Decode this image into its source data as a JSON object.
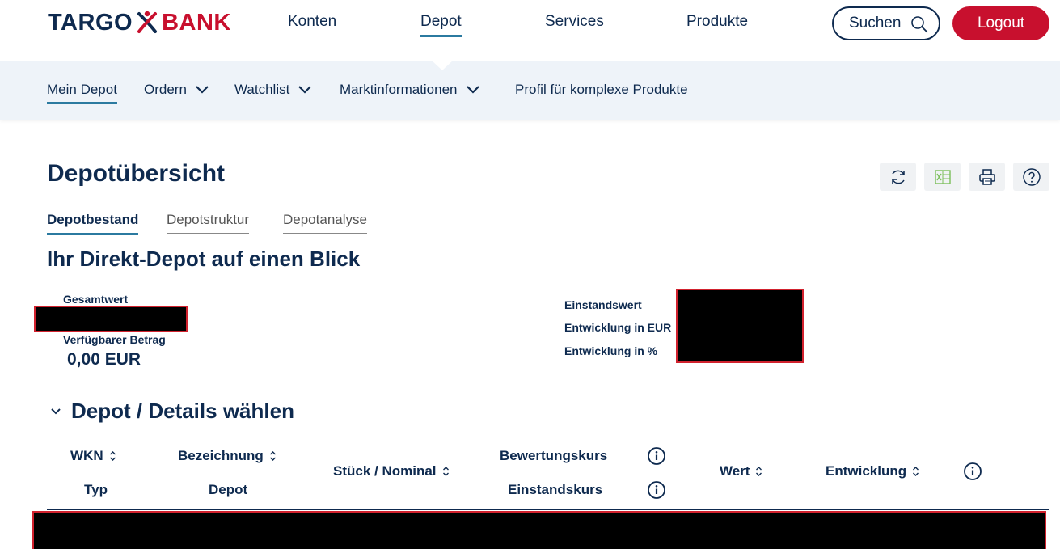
{
  "header": {
    "logo_left": "TARGO",
    "logo_right": "BANK",
    "nav": [
      {
        "label": "Konten"
      },
      {
        "label": "Depot"
      },
      {
        "label": "Services"
      },
      {
        "label": "Produkte"
      }
    ],
    "search_label": "Suchen",
    "logout_label": "Logout"
  },
  "subnav": {
    "items": [
      {
        "label": "Mein Depot"
      },
      {
        "label": "Ordern"
      },
      {
        "label": "Watchlist"
      },
      {
        "label": "Marktinformationen"
      },
      {
        "label": "Profil für komplexe Produkte"
      }
    ]
  },
  "page": {
    "title": "Depotübersicht",
    "tabs": [
      {
        "label": "Depotbestand"
      },
      {
        "label": "Depotstruktur"
      },
      {
        "label": "Depotanalyse"
      }
    ],
    "subtitle": "Ihr Direkt-Depot auf einen Blick"
  },
  "summary": {
    "gesamtwert_label": "Gesamtwert",
    "verfuegbar_label": "Verfügbarer Betrag",
    "verfuegbar_value": "0,00 EUR",
    "einstandswert_label": "Einstandswert",
    "entwicklung_eur_label": "Entwicklung in EUR",
    "entwicklung_pct_label": "Entwicklung in %"
  },
  "details": {
    "title": "Depot / Details wählen",
    "columns": {
      "wkn": "WKN",
      "typ": "Typ",
      "bezeichnung": "Bezeichnung",
      "depot": "Depot",
      "stueck": "Stück / Nominal",
      "bewertungskurs": "Bewertungskurs",
      "einstandskurs": "Einstandskurs",
      "wert": "Wert",
      "entwicklung": "Entwicklung"
    }
  },
  "colors": {
    "brand_navy": "#0e2a4f",
    "brand_red": "#c8102e",
    "accent_blue": "#2b7aa0",
    "subnav_bg": "#eef3f9"
  }
}
